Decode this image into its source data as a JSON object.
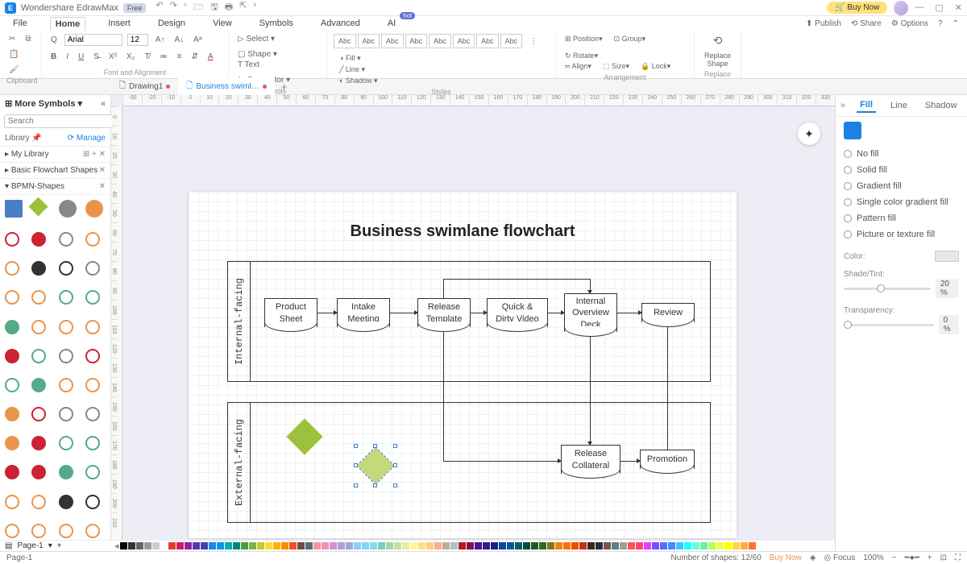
{
  "titlebar": {
    "app_name": "Wondershare EdrawMax",
    "free_badge": "Free",
    "buy_now": "🛒 Buy Now"
  },
  "menubar": {
    "items": [
      "File",
      "Home",
      "Insert",
      "Design",
      "View",
      "Symbols",
      "Advanced",
      "AI"
    ],
    "active_index": 1,
    "hot_badge": "hot",
    "right": {
      "publish": "⬆ Publish",
      "share": "⟲ Share",
      "options": "⚙ Options"
    }
  },
  "ribbon": {
    "clipboard": {
      "label": "Clipboard"
    },
    "font": {
      "name": "Arial",
      "size": "12",
      "label": "Font and Alignment"
    },
    "tools": {
      "select": "Select",
      "shape": "Shape",
      "text": "Text",
      "connector": "Connector",
      "label": "Tools"
    },
    "styles": {
      "abc": "Abc",
      "label": "Styles",
      "fill": "Fill",
      "line": "Line",
      "shadow": "Shadow"
    },
    "arrange": {
      "position": "Position",
      "group": "Group",
      "rotate": "Rotate",
      "align": "Align",
      "size": "Size",
      "lock": "Lock",
      "label": "Arrangement"
    },
    "replace": {
      "replace_shape": "Replace Shape",
      "label": "Replace"
    }
  },
  "doc_tabs": {
    "tab1": "Drawing1",
    "tab2": "Business swiml…"
  },
  "left": {
    "more_symbols": "More Symbols",
    "search_placeholder": "Search",
    "search_btn": "Search",
    "library": "Library",
    "manage": "⟳ Manage",
    "my_library": "My Library",
    "basic": "Basic Flowchart Shapes",
    "bpmn": "BPMN-Shapes"
  },
  "canvas": {
    "title": "Business swimlane flowchart",
    "lane1": "Internal-facing",
    "lane2": "External-facing",
    "boxes": {
      "product": "Product\nSheet",
      "intake": "Intake\nMeeting",
      "release_t": "Release\nTemplate",
      "quick": "Quick &\nDirty Video",
      "internal": "Internal\nOverview\nDeck",
      "review": "Review",
      "collateral": "Release\nCollateral",
      "promotion": "Promotion"
    }
  },
  "right_panel": {
    "tabs": {
      "fill": "Fill",
      "line": "Line",
      "shadow": "Shadow"
    },
    "options": [
      "No fill",
      "Solid fill",
      "Gradient fill",
      "Single color gradient fill",
      "Pattern fill",
      "Picture or texture fill"
    ],
    "color": "Color:",
    "shade": "Shade/Tint:",
    "shade_val": "20 %",
    "transparency": "Transparency:",
    "trans_val": "0 %"
  },
  "statusbar": {
    "page": "Page-1",
    "page_tab": "Page-1",
    "shapes": "Number of shapes: 12/60",
    "buy": "Buy Now",
    "focus": "Focus",
    "zoom": "100%"
  },
  "ruler_h": [
    "-30",
    "-20",
    "-10",
    "0",
    "10",
    "20",
    "30",
    "40",
    "50",
    "60",
    "70",
    "80",
    "90",
    "100",
    "110",
    "120",
    "130",
    "140",
    "150",
    "160",
    "170",
    "180",
    "190",
    "200",
    "210",
    "220",
    "230",
    "240",
    "250",
    "260",
    "270",
    "280",
    "290",
    "300",
    "310",
    "320",
    "330"
  ],
  "ruler_v": [
    "0",
    "10",
    "20",
    "30",
    "40",
    "50",
    "60",
    "70",
    "80",
    "90",
    "100",
    "110",
    "120",
    "130",
    "140",
    "150",
    "160",
    "170",
    "180",
    "190",
    "200",
    "210"
  ],
  "palette": [
    "#000",
    "#333",
    "#666",
    "#999",
    "#ccc",
    "#fff",
    "#e53935",
    "#d81b60",
    "#8e24aa",
    "#5e35b1",
    "#3949ab",
    "#1e88e5",
    "#039be5",
    "#00acc1",
    "#00897b",
    "#43a047",
    "#7cb342",
    "#c0ca33",
    "#fdd835",
    "#ffb300",
    "#fb8c00",
    "#f4511e",
    "#6d4c41",
    "#546e7a",
    "#ef9a9a",
    "#f48fb1",
    "#ce93d8",
    "#b39ddb",
    "#9fa8da",
    "#90caf9",
    "#81d4fa",
    "#80deea",
    "#80cbc4",
    "#a5d6a7",
    "#c5e1a5",
    "#e6ee9c",
    "#fff59d",
    "#ffe082",
    "#ffcc80",
    "#ffab91",
    "#bcaaa4",
    "#b0bec5",
    "#b71c1c",
    "#880e4f",
    "#4a148c",
    "#311b92",
    "#1a237e",
    "#0d47a1",
    "#01579b",
    "#006064",
    "#004d40",
    "#1b5e20",
    "#33691e",
    "#827717",
    "#f57f17",
    "#ff6f00",
    "#e65100",
    "#bf360c",
    "#3e2723",
    "#263238",
    "#795548",
    "#607d8b",
    "#9e9e9e",
    "#ff5252",
    "#ff4081",
    "#e040fb",
    "#7c4dff",
    "#536dfe",
    "#448aff",
    "#40c4ff",
    "#18ffff",
    "#64ffda",
    "#69f0ae",
    "#b2ff59",
    "#eeff41",
    "#ffff00",
    "#ffd740",
    "#ffab40",
    "#ff6e40"
  ]
}
